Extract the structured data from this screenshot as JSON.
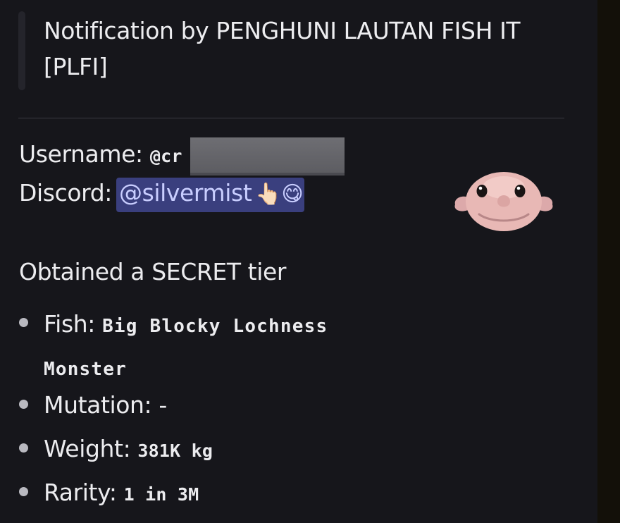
{
  "embed": {
    "title": "Notification by PENGHUNI LAUTAN FISH IT [PLFI]",
    "username": {
      "label": "Username:",
      "value_visible": "@cr"
    },
    "discord": {
      "label": "Discord:",
      "mention": "@silvermist",
      "emoji": "👆🏻😋"
    },
    "thumbnail": {
      "icon": "blobfish-icon"
    },
    "heading": "Obtained a SECRET tier",
    "fields": [
      {
        "label": "Fish:",
        "value": "Big Blocky Lochness Monster"
      },
      {
        "label": "Mutation:",
        "value": "-"
      },
      {
        "label": "Weight:",
        "value": "381K kg"
      },
      {
        "label": "Rarity:",
        "value": "1 in 3M"
      }
    ]
  },
  "colors": {
    "background": "#16161b",
    "mention_background": "#3a3f7e",
    "mention_text": "#c9ceff",
    "text": "#ececef"
  }
}
